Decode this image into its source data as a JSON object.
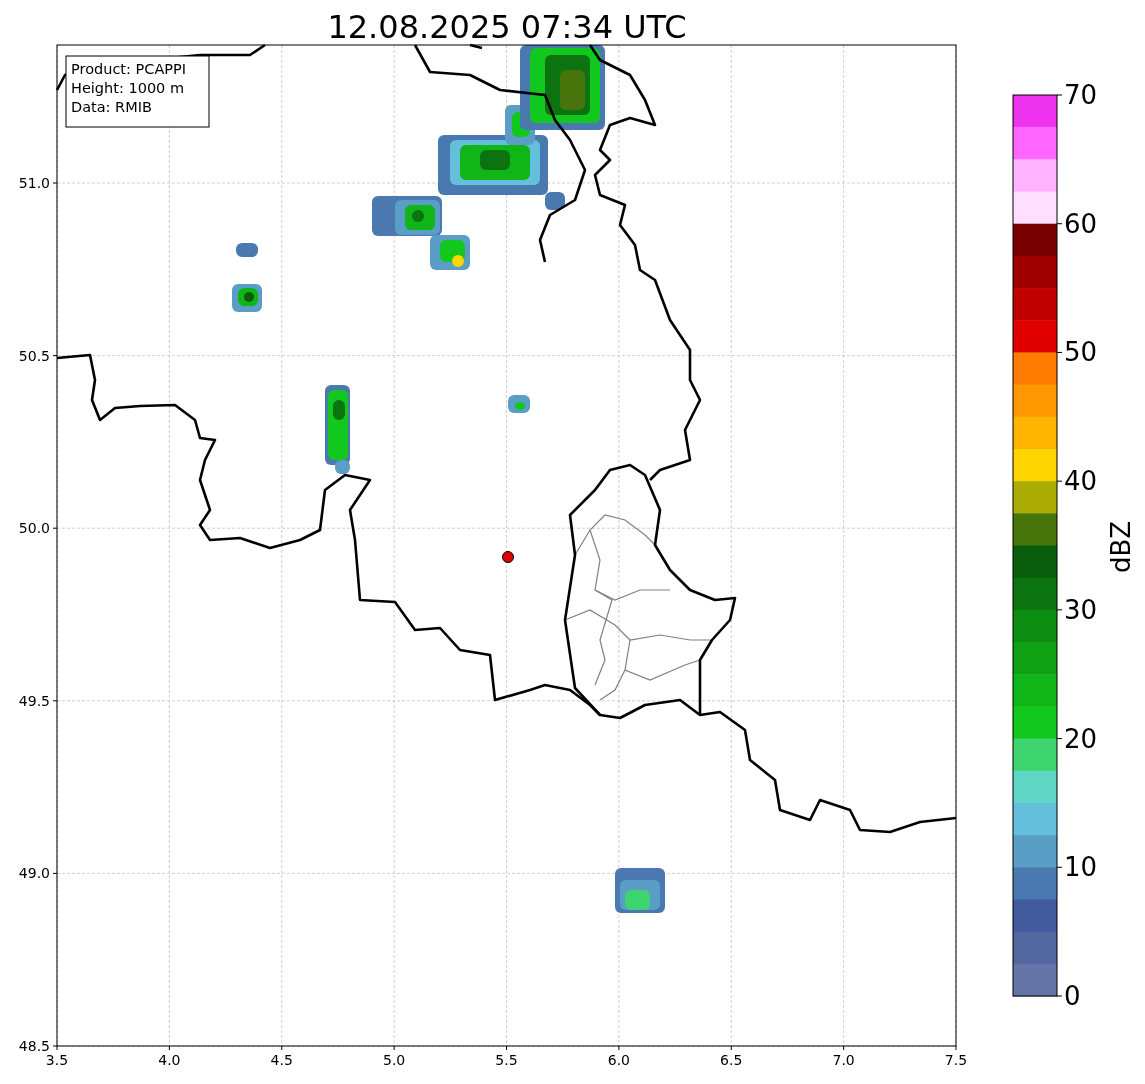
{
  "title": "12.08.2025 07:34 UTC",
  "info_box": [
    "Product: PCAPPI",
    "Height: 1000 m",
    "Data: RMIB"
  ],
  "x_ticks": [
    "3.5",
    "4.0",
    "4.5",
    "5.0",
    "5.5",
    "6.0",
    "6.5",
    "7.0",
    "7.5"
  ],
  "y_ticks": [
    "51.0",
    "50.5",
    "50.0",
    "49.5",
    "49.0",
    "48.5"
  ],
  "colorbar": {
    "label": "dBZ",
    "ticks": [
      "70",
      "60",
      "50",
      "40",
      "30",
      "20",
      "10",
      "0"
    ],
    "bins": [
      {
        "color": "#ee33ee"
      },
      {
        "color": "#ff66ff"
      },
      {
        "color": "#ffb3ff"
      },
      {
        "color": "#ffdfff"
      },
      {
        "color": "#780000"
      },
      {
        "color": "#a00000"
      },
      {
        "color": "#c00000"
      },
      {
        "color": "#e00000"
      },
      {
        "color": "#ff7a00"
      },
      {
        "color": "#ff9800"
      },
      {
        "color": "#ffb400"
      },
      {
        "color": "#ffd500"
      },
      {
        "color": "#acad04"
      },
      {
        "color": "#47750c"
      },
      {
        "color": "#085c0b"
      },
      {
        "color": "#0b7310"
      },
      {
        "color": "#0d8c12"
      },
      {
        "color": "#0fa114"
      },
      {
        "color": "#10b518"
      },
      {
        "color": "#12c81e"
      },
      {
        "color": "#3ed46f"
      },
      {
        "color": "#60d6c4"
      },
      {
        "color": "#64bfdc"
      },
      {
        "color": "#5a9ec6"
      },
      {
        "color": "#4a78b0"
      },
      {
        "color": "#425a9e"
      },
      {
        "color": "#52679f"
      },
      {
        "color": "#6474a6"
      }
    ]
  }
}
